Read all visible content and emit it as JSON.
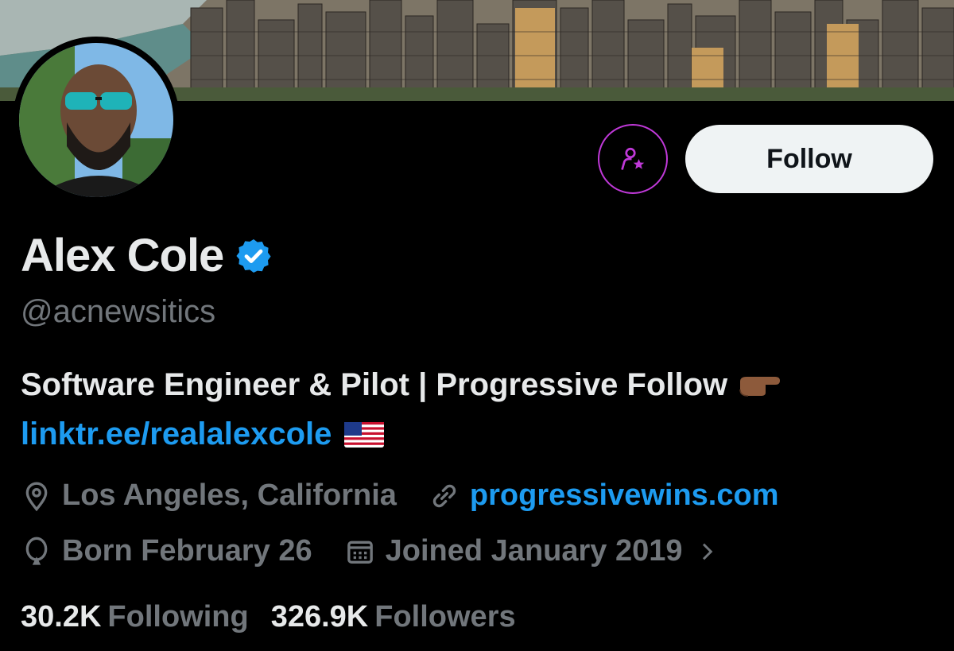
{
  "profile": {
    "display_name": "Alex Cole",
    "handle": "@acnewsitics",
    "bio": "Software Engineer & Pilot | Progressive Follow",
    "bio_emoji": "pointing-right-hand-emoji",
    "bio_link": "linktr.ee/realalexcole",
    "bio_link_emoji": "us-flag-emoji",
    "location": "Los Angeles, California",
    "website": "progressivewins.com",
    "birthday": "Born February 26",
    "joined": "Joined January 2019",
    "following_count": "30.2K",
    "following_label": "Following",
    "followers_count": "326.9K",
    "followers_label": "Followers"
  },
  "actions": {
    "follow_label": "Follow",
    "subscribe_icon": "person-star-icon"
  },
  "colors": {
    "background": "#000000",
    "text_primary": "#e7e9ea",
    "text_secondary": "#71767b",
    "link": "#1d9bf0",
    "verified": "#1d9bf0",
    "subscribe_accent": "#c039d9",
    "follow_button_bg": "#eff3f4"
  }
}
